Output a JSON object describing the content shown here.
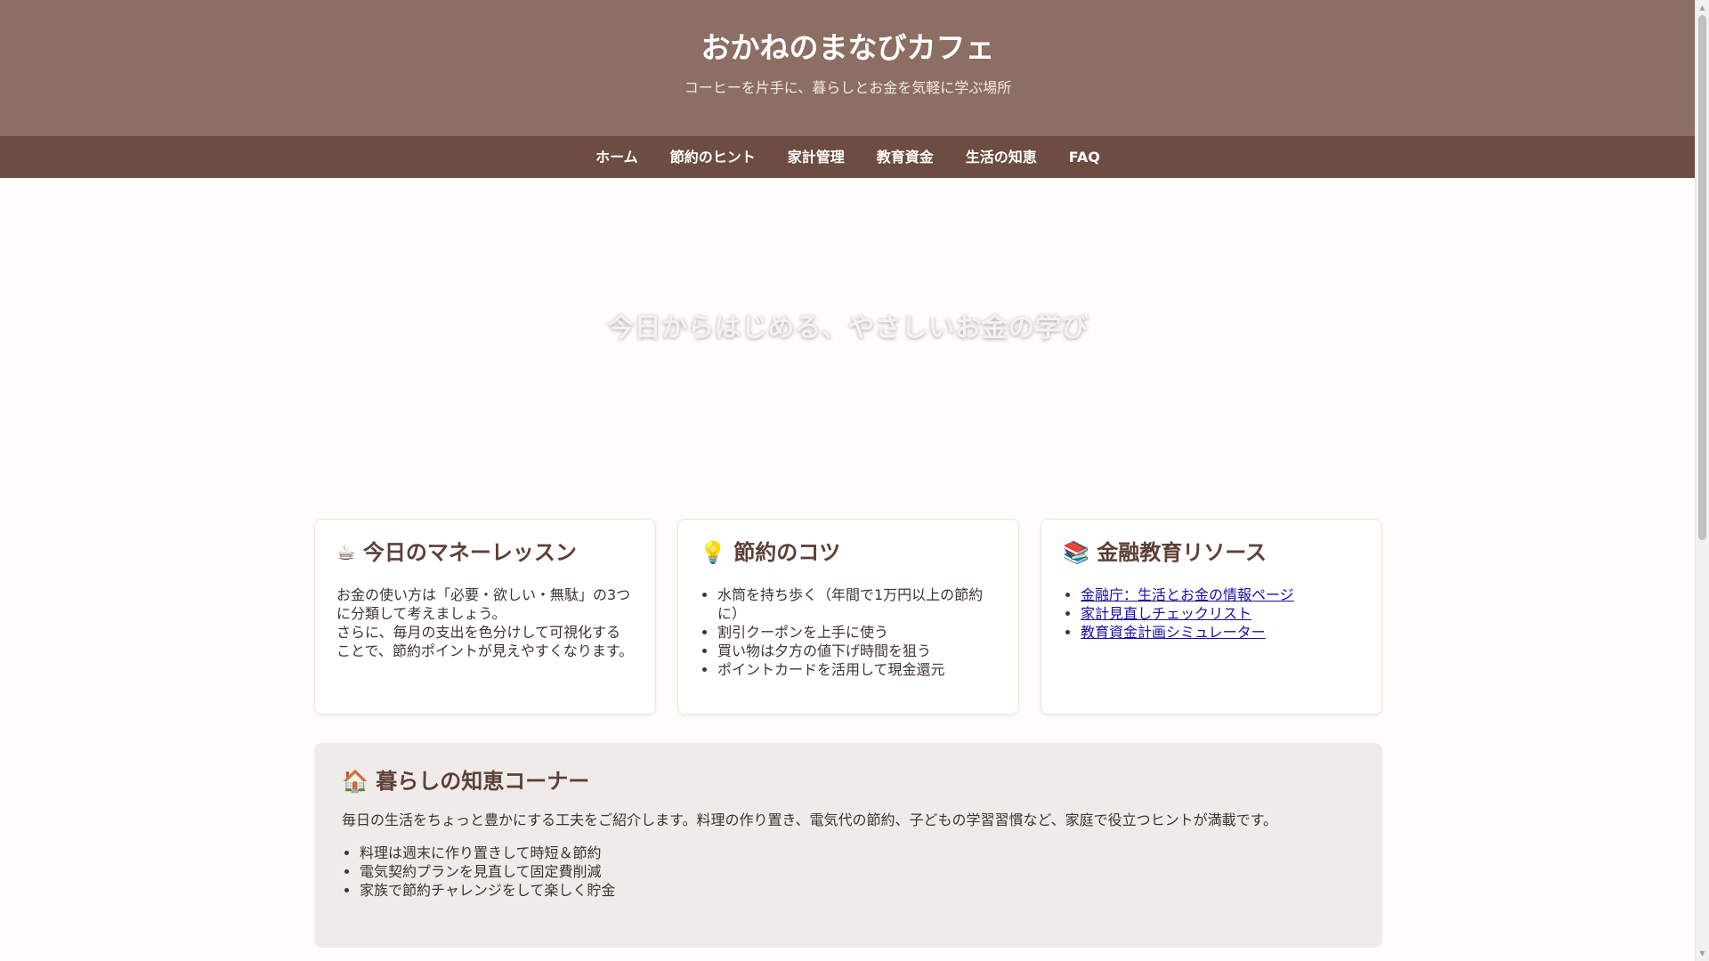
{
  "site": {
    "title": "おかねのまなびカフェ",
    "tagline": "コーヒーを片手に、暮らしとお金を気軽に学ぶ場所"
  },
  "nav": {
    "items": [
      "ホーム",
      "節約のヒント",
      "家計管理",
      "教育資金",
      "生活の知恵",
      "FAQ"
    ]
  },
  "hero": {
    "heading": "今日からはじめる、やさしいお金の学び"
  },
  "cards": {
    "lesson": {
      "icon": "☕",
      "title": "今日のマネーレッスン",
      "paragraph": "お金の使い方は「必要・欲しい・無駄」の3つに分類して考えましょう。",
      "paragraph2": "さらに、毎月の支出を色分けして可視化することで、節約ポイントが見えやすくなります。"
    },
    "tips": {
      "icon": "💡",
      "title": "節約のコツ",
      "items": [
        "水筒を持ち歩く（年間で1万円以上の節約に）",
        "割引クーポンを上手に使う",
        "買い物は夕方の値下げ時間を狙う",
        "ポイントカードを活用して現金還元"
      ]
    },
    "resources": {
      "icon": "📚",
      "title": "金融教育リソース",
      "links": [
        "金融庁：生活とお金の情報ページ",
        "家計見直しチェックリスト",
        "教育資金計画シミュレーター"
      ]
    }
  },
  "wisdom": {
    "icon": "🏠",
    "title": "暮らしの知恵コーナー",
    "text": "毎日の生活をちょっと豊かにする工夫をご紹介します。料理の作り置き、電気代の節約、子どもの学習習慣など、家庭で役立つヒントが満載です。",
    "items": [
      "料理は週末に作り置きして時短＆節約",
      "電気契約プランを見直して固定費削減",
      "家族で節約チャレンジをして楽しく貯金"
    ]
  },
  "colors": {
    "header_bg": "#8d6e63",
    "nav_bg": "#6d4c41",
    "page_bg": "#fffdf9",
    "heading_color": "#5d4037",
    "section_bg": "#efebe9",
    "link_color": "#1a0dab"
  }
}
